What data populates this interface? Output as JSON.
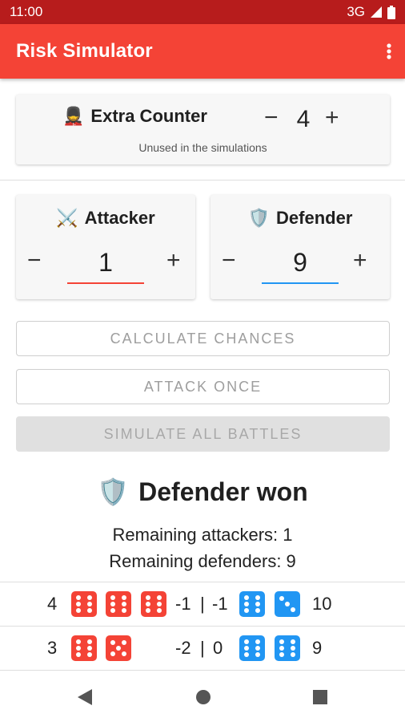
{
  "status_bar": {
    "time": "11:00",
    "network": "3G"
  },
  "app_bar": {
    "title": "Risk Simulator"
  },
  "extra_counter": {
    "emoji": "💂",
    "title": "Extra Counter",
    "value": "4",
    "subtitle": "Unused in the simulations",
    "minus": "−",
    "plus": "+"
  },
  "attacker": {
    "emoji": "⚔️",
    "title": "Attacker",
    "value": "1",
    "minus": "−",
    "plus": "+",
    "color": "#f44336"
  },
  "defender": {
    "emoji": "🛡️",
    "title": "Defender",
    "value": "9",
    "minus": "−",
    "plus": "+",
    "color": "#2196f3"
  },
  "buttons": {
    "calculate": "CALCULATE CHANCES",
    "attack_once": "ATTACK ONCE",
    "simulate_all": "SIMULATE ALL BATTLES"
  },
  "result": {
    "emoji": "🛡️",
    "title": "Defender won",
    "remaining_attackers": "Remaining attackers: 1",
    "remaining_defenders": "Remaining defenders: 9"
  },
  "battles": [
    {
      "attackers": "4",
      "attacker_dice": [
        6,
        6,
        6
      ],
      "attacker_loss": "-1",
      "separator": "|",
      "defender_loss": "-1",
      "defender_dice": [
        6,
        3
      ],
      "defenders": "10"
    },
    {
      "attackers": "3",
      "attacker_dice": [
        6,
        5
      ],
      "attacker_loss": "-2",
      "separator": "|",
      "defender_loss": "0",
      "defender_dice": [
        6,
        6
      ],
      "defenders": "9"
    }
  ],
  "nav": {
    "back": "back-icon",
    "home": "home-icon",
    "recents": "recents-icon"
  }
}
